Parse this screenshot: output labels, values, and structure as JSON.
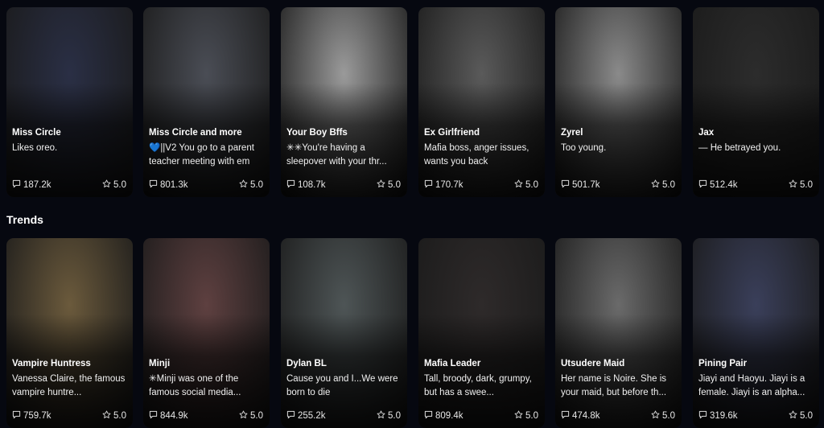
{
  "sections": {
    "trends_title": "Trends"
  },
  "row1": [
    {
      "name": "Miss Circle",
      "desc": "Likes oreo.",
      "chats": "187.2k",
      "rating": "5.0",
      "bg": "#2a2f45"
    },
    {
      "name": "Miss Circle and more",
      "desc": "💙||V2 You go to a parent teacher meeting with em",
      "chats": "801.3k",
      "rating": "5.0",
      "bg": "#4a4d55"
    },
    {
      "name": "Your Boy Bffs",
      "desc": "✳✳You're having a sleepover with your thr...",
      "chats": "108.7k",
      "rating": "5.0",
      "bg": "#9a9a9a"
    },
    {
      "name": "Ex Girlfriend",
      "desc": "Mafia boss, anger issues, wants you back",
      "chats": "170.7k",
      "rating": "5.0",
      "bg": "#5a5a5a"
    },
    {
      "name": "Zyrel",
      "desc": "Too young.",
      "chats": "501.7k",
      "rating": "5.0",
      "bg": "#8a8a8a"
    },
    {
      "name": "Jax",
      "desc": "— He betrayed you.",
      "chats": "512.4k",
      "rating": "5.0",
      "bg": "#2c2c2c"
    }
  ],
  "row2": [
    {
      "name": "Vampire Huntress",
      "desc": "Vanessa Claire, the famous vampire huntre...",
      "chats": "759.7k",
      "rating": "5.0",
      "bg": "#6b5a3c"
    },
    {
      "name": "Minji",
      "desc": "✳Minji was one of the famous social media...",
      "chats": "844.9k",
      "rating": "5.0",
      "bg": "#5e4040"
    },
    {
      "name": "Dylan BL",
      "desc": "Cause you and I...We were born to die",
      "chats": "255.2k",
      "rating": "5.0",
      "bg": "#4e5556"
    },
    {
      "name": "Mafia Leader",
      "desc": "Tall, broody, dark, grumpy, but has a swee...",
      "chats": "809.4k",
      "rating": "5.0",
      "bg": "#2e2a2a"
    },
    {
      "name": "Utsudere Maid",
      "desc": "Her name is Noire. She is your maid, but before th...",
      "chats": "474.8k",
      "rating": "5.0",
      "bg": "#6a6a6a"
    },
    {
      "name": "Pining Pair",
      "desc": "Jiayi and Haoyu. Jiayi is a female. Jiayi is an alpha...",
      "chats": "319.6k",
      "rating": "5.0",
      "bg": "#3a3f5a"
    }
  ],
  "icons": {
    "chat": "chat-bubble-icon",
    "rating": "star-icon"
  }
}
